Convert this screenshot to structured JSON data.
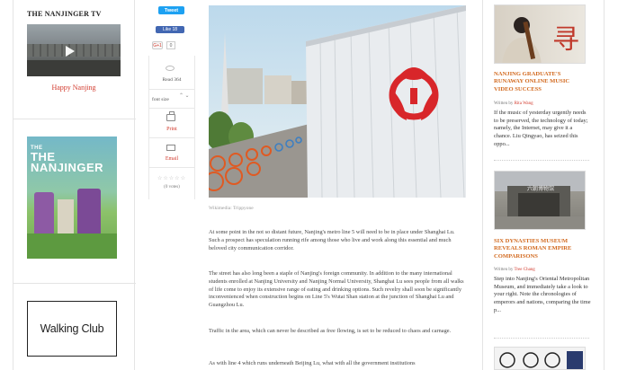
{
  "sidebar_left": {
    "tv_title": "THE NANJINGER TV",
    "video_link": "Happy Nanjing",
    "magazine_title": "THE NANJINGER",
    "walking_club": "Walking Club"
  },
  "share": {
    "tweet": "Tweet",
    "fb_like": "Like 18",
    "gplus": "G+1",
    "gplus_count": "0",
    "reads": "Read 364",
    "font_size": "font size",
    "print": "Print",
    "email": "Email",
    "stars": "☆☆☆☆☆",
    "votes": "(0 votes)"
  },
  "article": {
    "caption": "Wikimedia: Trippyone",
    "paragraphs": [
      "At some point in the not so distant future, Nanjing's metro line 5 will need to be in place under Shanghai Lu. Such a prospect has speculation running rife among those who live and work along this essential and much beloved city communication corridor.",
      "The street has also long been a staple of Nanjing's foreign community. In addition to the many international students enrolled at Nanjing University and Nanjing Normal University, Shanghai Lu sees people from all walks of life come to enjoy its extensive range of eating and drinking options. Such revelry shall soon be significantly inconvenienced when construction begins on Line 5's Wutai Shan station at the junction of Shanghai Lu and Guangzhou Lu.",
      "Traffic in the area, which can never be described as free flowing, is set to be reduced to chaos and carnage.",
      "As with line 4 which runs underneath Beijing Lu, what with all the government institutions"
    ]
  },
  "related": [
    {
      "title": "NANJING GRADUATE'S RUNAWAY ONLINE MUSIC VIDEO SUCCESS",
      "by_label": "Written by",
      "author": "Rita Wang",
      "excerpt": "If the music of yesterday urgently needs to be preserved, the technology of today; namely, the Internet, may give it a chance. Liu Qingyao, has seized this oppo..."
    },
    {
      "title": "SIX DYNASTIES MUSEUM REVEALS ROMAN EMPIRE COMPARISONS",
      "by_label": "Written by",
      "author": "Tree Chang",
      "excerpt": "Step into Nanjing's Oriental Metropolitan Museum, and immediately take a look to your right. Note the chronologies of emperors and nations, comparing the time p..."
    }
  ],
  "colors": {
    "accent_red": "#d23b2e",
    "related_title": "#d2691e",
    "tweet_blue": "#1da1f2",
    "fb_blue": "#4267b2"
  }
}
